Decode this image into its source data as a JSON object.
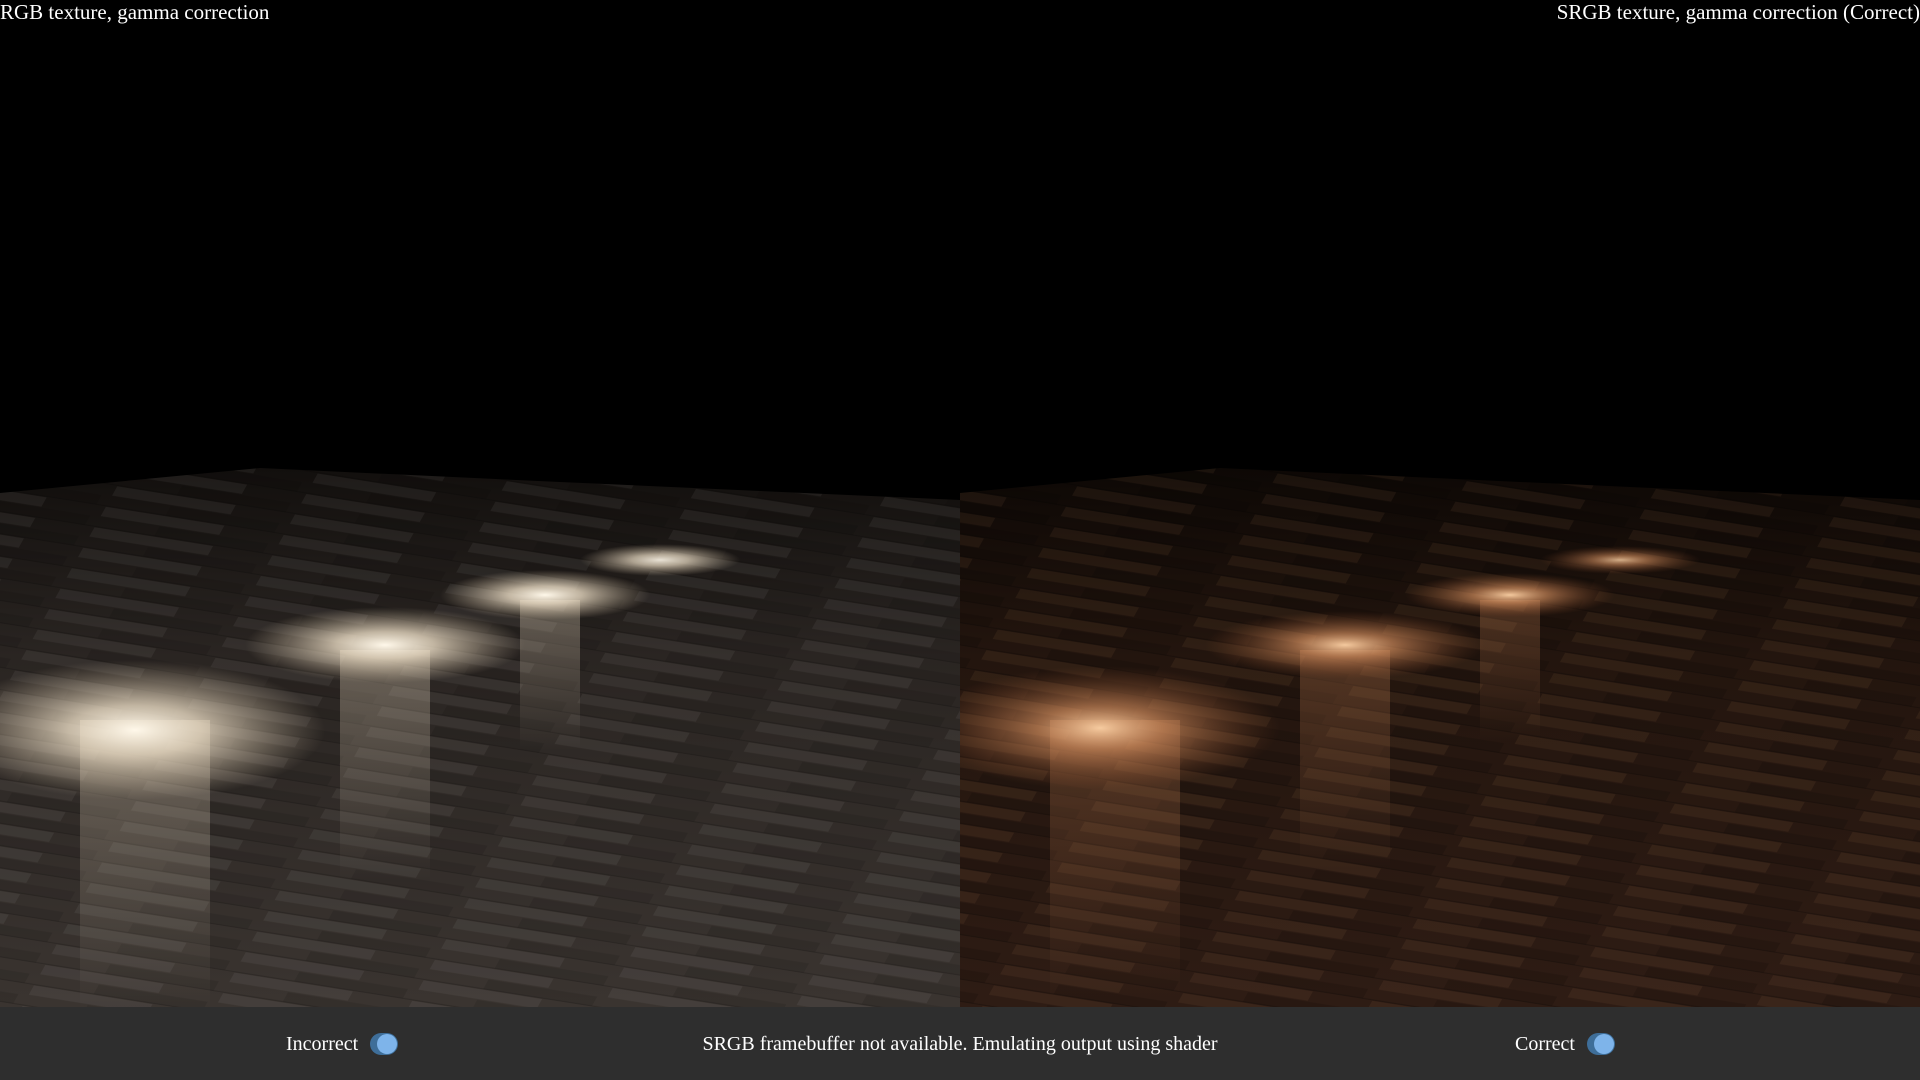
{
  "panes": {
    "left": {
      "title": "RGB texture, gamma correction",
      "light_color": "#fff2dc",
      "floor_tint": "#3a3530"
    },
    "right": {
      "title": "SRGB texture, gamma correction (Correct)",
      "light_color": "#ffb080",
      "floor_tint": "#2e1c14"
    }
  },
  "bottom_bar": {
    "left_toggle_label": "Incorrect",
    "right_toggle_label": "Correct",
    "status_text": "SRGB framebuffer not available. Emulating output using shader"
  },
  "colors": {
    "background": "#000000",
    "bar": "#2e2e2e",
    "toggle_track": "#3e6e99",
    "toggle_knob": "#7eb4ea"
  }
}
